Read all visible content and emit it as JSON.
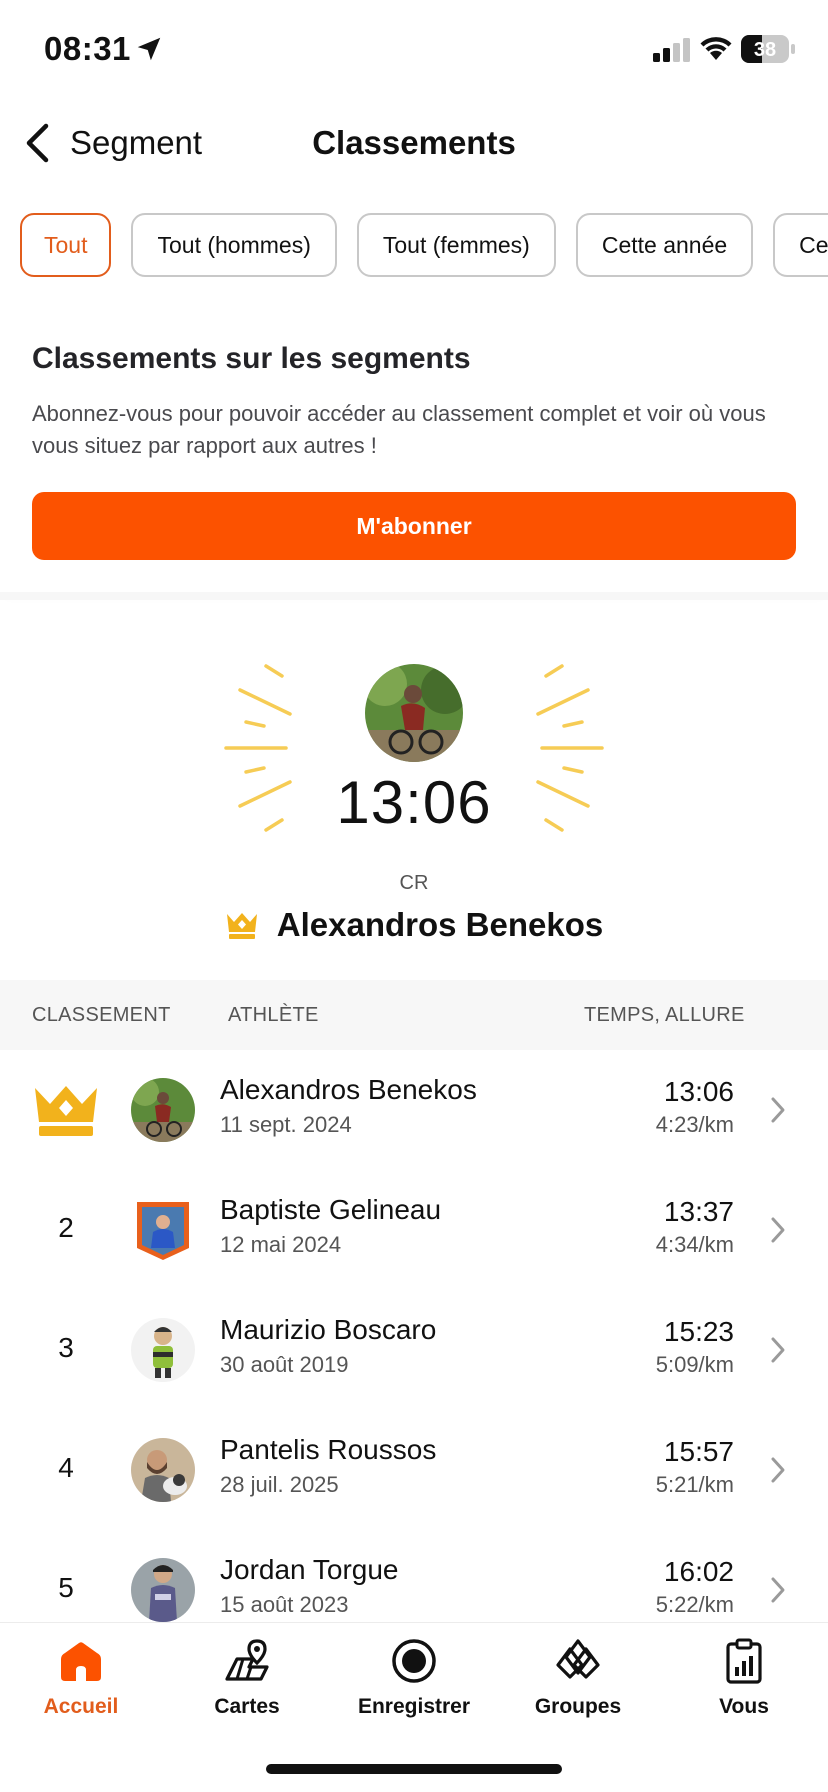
{
  "status_bar": {
    "time": "08:31",
    "battery": "38"
  },
  "nav": {
    "back_label": "Segment",
    "title": "Classements"
  },
  "filters": [
    "Tout",
    "Tout (hommes)",
    "Tout (femmes)",
    "Cette année",
    "Ce"
  ],
  "subscribe": {
    "title": "Classements sur les segments",
    "text": "Abonnez-vous pour pouvoir accéder au classement complet et voir où vous vous situez par rapport aux autres !",
    "button": "M'abonner"
  },
  "leader": {
    "time": "13:06",
    "label": "CR",
    "name": "Alexandros Benekos"
  },
  "table": {
    "headers": {
      "rank": "CLASSEMENT",
      "athlete": "ATHLÈTE",
      "time": "TEMPS, ALLURE"
    },
    "rows": [
      {
        "rank": "",
        "name": "Alexandros Benekos",
        "date": "11 sept. 2024",
        "time": "13:06",
        "pace": "4:23/km"
      },
      {
        "rank": "2",
        "name": "Baptiste Gelineau",
        "date": "12 mai 2024",
        "time": "13:37",
        "pace": "4:34/km"
      },
      {
        "rank": "3",
        "name": "Maurizio Boscaro",
        "date": "30 août 2019",
        "time": "15:23",
        "pace": "5:09/km"
      },
      {
        "rank": "4",
        "name": "Pantelis Roussos",
        "date": "28 juil. 2025",
        "time": "15:57",
        "pace": "5:21/km"
      },
      {
        "rank": "5",
        "name": "Jordan Torgue",
        "date": "15 août 2023",
        "time": "16:02",
        "pace": "5:22/km"
      }
    ]
  },
  "tabs": [
    {
      "label": "Accueil",
      "icon": "home-icon"
    },
    {
      "label": "Cartes",
      "icon": "maps-icon"
    },
    {
      "label": "Enregistrer",
      "icon": "record-icon"
    },
    {
      "label": "Groupes",
      "icon": "groups-icon"
    },
    {
      "label": "Vous",
      "icon": "you-icon"
    }
  ],
  "colors": {
    "accent": "#fc5200",
    "accent_text": "#e25d1c",
    "crown": "#f2b21c",
    "rays": "#f6cc55"
  }
}
